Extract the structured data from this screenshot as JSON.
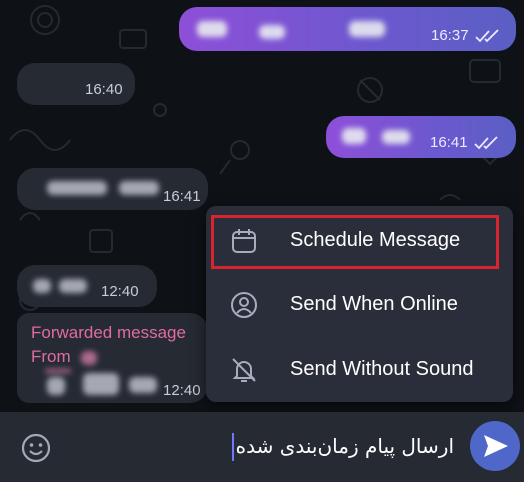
{
  "chat": {
    "messages": [
      {
        "direction": "outgoing",
        "time": "16:37"
      },
      {
        "direction": "incoming",
        "time": "16:40"
      },
      {
        "direction": "outgoing",
        "time": "16:41"
      },
      {
        "direction": "incoming",
        "time": "16:41"
      },
      {
        "direction": "incoming",
        "time": "12:40"
      },
      {
        "direction": "incoming",
        "time": "12:40",
        "forwarded_label": "Forwarded message",
        "from_label": "From"
      }
    ]
  },
  "send_menu": {
    "items": [
      {
        "label": "Schedule Message",
        "icon": "calendar-icon",
        "highlighted": true
      },
      {
        "label": "Send When Online",
        "icon": "user-online-icon"
      },
      {
        "label": "Send Without Sound",
        "icon": "bell-off-icon"
      }
    ]
  },
  "composer": {
    "input_value": "ارسال پیام زمان‌بندی شده",
    "emoji_icon": "emoji-icon",
    "send_icon": "send-icon"
  },
  "colors": {
    "background": "#0e1116",
    "incoming_bubble": "#262a33",
    "outgoing_start": "#8e4fd8",
    "outgoing_end": "#5a5fc4",
    "forwarded_text": "#e06c9f",
    "highlight_border": "#d8242e",
    "send_button": "#4f67c8"
  }
}
